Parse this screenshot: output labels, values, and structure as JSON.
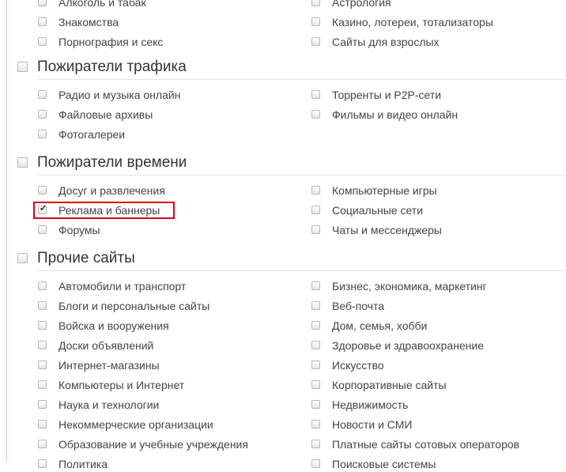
{
  "sections": [
    {
      "title": "",
      "items": [
        [
          "Алкоголь и табак",
          "Астрология"
        ],
        [
          "Знакомства",
          "Казино, лотереи, тотализаторы"
        ],
        [
          "Порнография и секс",
          "Сайты для взрослых"
        ]
      ]
    },
    {
      "title": "Пожиратели трафика",
      "items": [
        [
          "Радио и музыка онлайн",
          "Торренты и P2P-сети"
        ],
        [
          "Файловые архивы",
          "Фильмы и видео онлайн"
        ],
        [
          "Фотогалереи",
          ""
        ]
      ]
    },
    {
      "title": "Пожиратели времени",
      "items": [
        [
          "Досуг и развлечения",
          "Компьютерные игры"
        ],
        [
          "Реклама и баннеры",
          "Социальные сети"
        ],
        [
          "Форумы",
          "Чаты и мессенджеры"
        ]
      ]
    },
    {
      "title": "Прочие сайты",
      "items": [
        [
          "Автомобили и транспорт",
          "Бизнес, экономика, маркетинг"
        ],
        [
          "Блоги и персональные сайты",
          "Веб-почта"
        ],
        [
          "Войска и вооружения",
          "Дом, семья, хобби"
        ],
        [
          "Доски объявлений",
          "Здоровье и здравоохранение"
        ],
        [
          "Интернет-магазины",
          "Искусство"
        ],
        [
          "Компьютеры и Интернет",
          "Корпоративные сайты"
        ],
        [
          "Наука и технологии",
          "Недвижимость"
        ],
        [
          "Некоммерческие организации",
          "Новости и СМИ"
        ],
        [
          "Образование и учебные учреждения",
          "Платные сайты сотовых операторов"
        ],
        [
          "Политика",
          "Поисковые системы"
        ]
      ]
    }
  ],
  "checked": [
    "Реклама и баннеры"
  ],
  "highlighted_item": "Реклама и баннеры",
  "colors": {
    "highlight_border": "#d9001b",
    "left_rule": "#e9c3c3",
    "text": "#444444",
    "header_text": "#333333"
  }
}
